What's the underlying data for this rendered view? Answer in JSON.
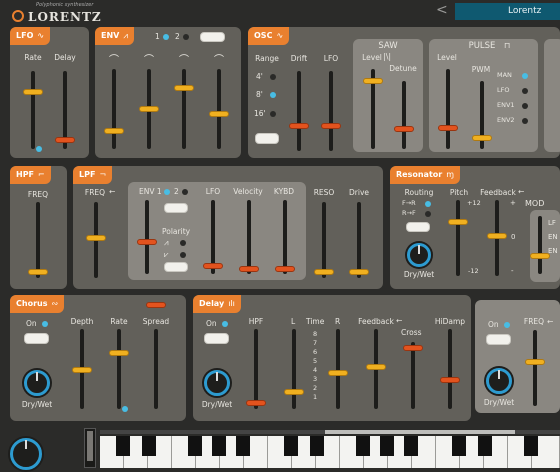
{
  "brand": {
    "name": "LORENTZ",
    "tagline": "Polyphonic synthesizer"
  },
  "header": {
    "prev_glyph": "<",
    "preset": "Lorentz"
  },
  "lfo": {
    "title": "LFO",
    "rate": "Rate",
    "delay": "Delay"
  },
  "env": {
    "title": "ENV",
    "sel1": "1",
    "sel2": "2"
  },
  "osc": {
    "title": "OSC",
    "range": "Range",
    "range_opts": [
      "4'",
      "8'",
      "16'"
    ],
    "drift": "Drift",
    "lfo": "LFO",
    "saw": {
      "title": "SAW",
      "level": "Level",
      "detune": "Detune"
    },
    "pulse": {
      "title": "PULSE",
      "level": "Level",
      "pwm": "PWM",
      "mods": [
        "MAN",
        "LFO",
        "ENV1",
        "ENV2"
      ]
    }
  },
  "hpf": {
    "title": "HPF",
    "freq": "FREQ"
  },
  "lpf": {
    "title": "LPF",
    "freq": "FREQ",
    "env1": "ENV 1",
    "env2": "2",
    "lfo": "LFO",
    "velocity": "Velocity",
    "kybd": "KYBD",
    "reso": "RESO",
    "drive": "Drive",
    "polarity": "Polarity"
  },
  "resonator": {
    "title": "Resonator",
    "routing": "Routing",
    "routes": [
      "F→R",
      "R→F"
    ],
    "pitch": "Pitch",
    "feedback": "Feedback",
    "mod": "MOD",
    "plus12": "+12",
    "minus12": "-12",
    "plus": "+",
    "minus": "-",
    "zero": "0",
    "drywet": "Dry/Wet",
    "lfo_cut": "LF",
    "env1_cut": "EN",
    "env2_cut": "EN"
  },
  "chorus": {
    "title": "Chorus",
    "on": "On",
    "depth": "Depth",
    "rate": "Rate",
    "spread": "Spread",
    "drywet": "Dry/Wet"
  },
  "delay": {
    "title": "Delay",
    "on": "On",
    "hpf": "HPF",
    "l": "L",
    "time": "Time",
    "r": "R",
    "feedback": "Feedback",
    "cross": "Cross",
    "hidamp": "HiDamp",
    "drywet": "Dry/Wet",
    "ticks": [
      "8",
      "7",
      "6",
      "5",
      "4",
      "3",
      "2",
      "1"
    ]
  },
  "reverb": {
    "on": "On",
    "freq": "FREQ",
    "drywet": "Dry/Wet"
  }
}
